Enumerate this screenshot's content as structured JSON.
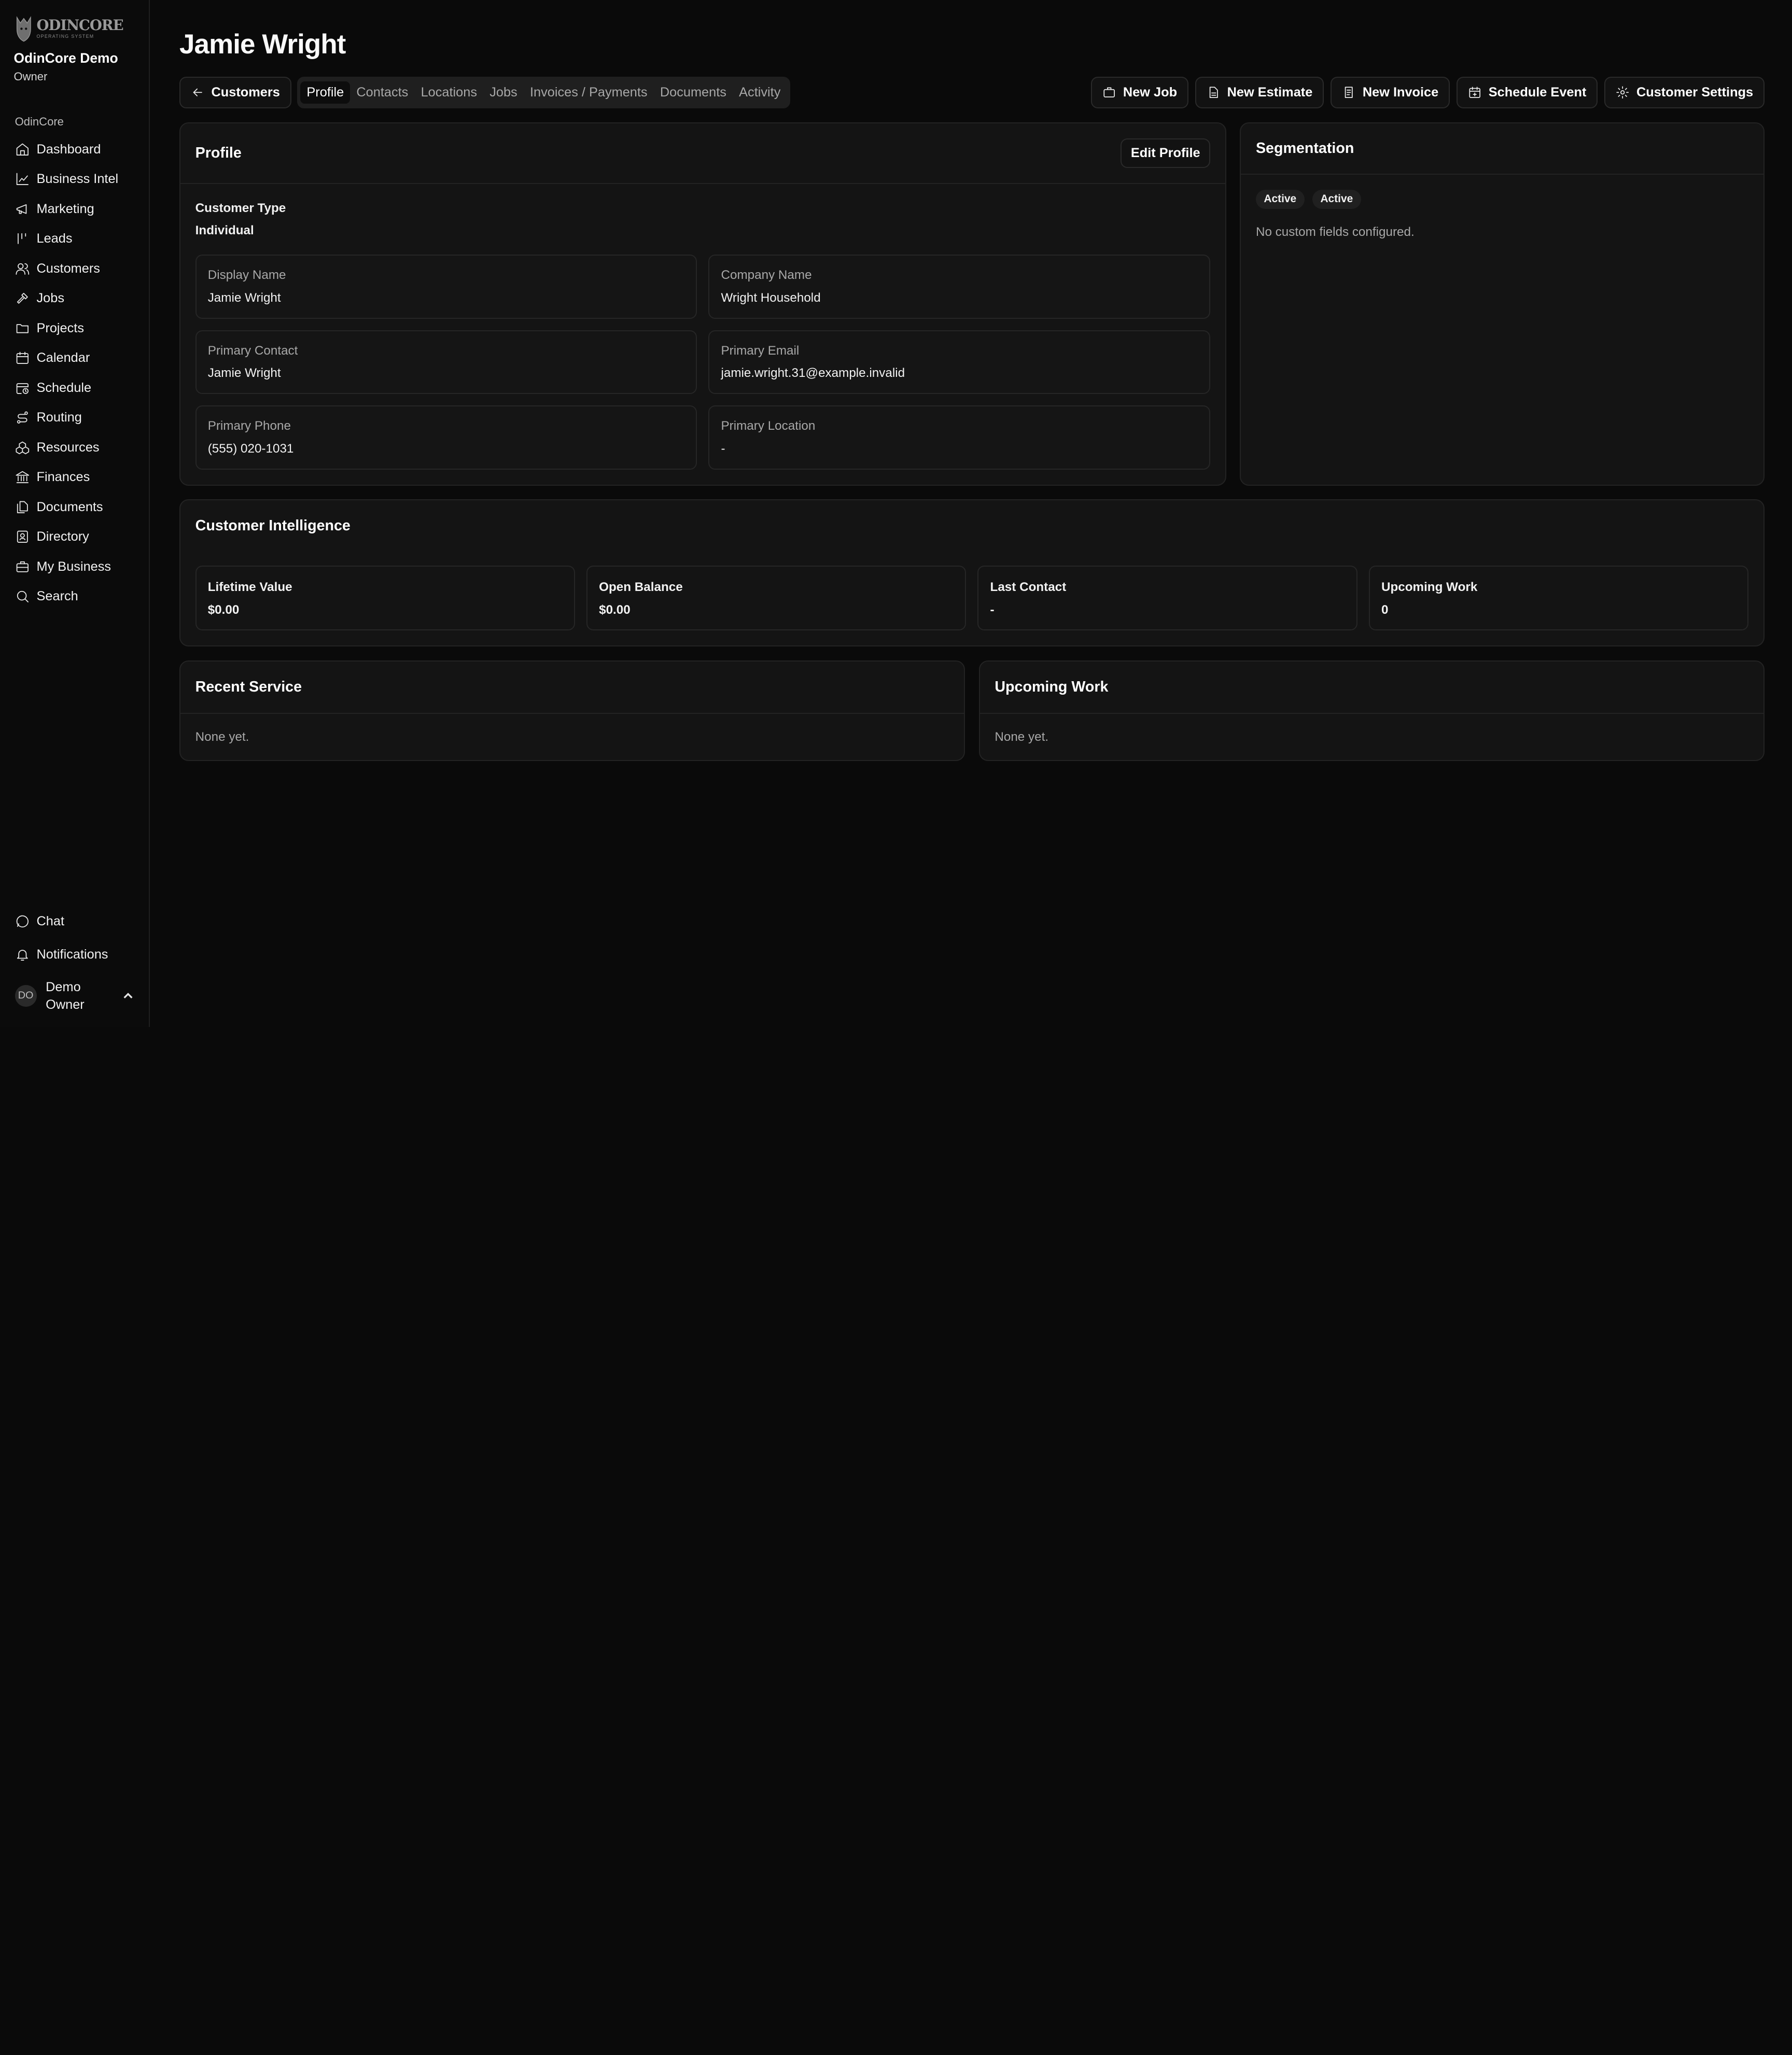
{
  "brand": {
    "logo_word": "ODINCORE",
    "logo_sub": "OPERATING SYSTEM",
    "org_name": "OdinCore Demo",
    "org_role": "Owner"
  },
  "sidebar": {
    "section_label": "OdinCore",
    "items": [
      {
        "label": "Dashboard",
        "icon": "home-icon"
      },
      {
        "label": "Business Intel",
        "icon": "chart-line-icon"
      },
      {
        "label": "Marketing",
        "icon": "megaphone-icon"
      },
      {
        "label": "Leads",
        "icon": "leads-icon"
      },
      {
        "label": "Customers",
        "icon": "users-icon"
      },
      {
        "label": "Jobs",
        "icon": "hammer-icon"
      },
      {
        "label": "Projects",
        "icon": "folder-icon"
      },
      {
        "label": "Calendar",
        "icon": "calendar-icon"
      },
      {
        "label": "Schedule",
        "icon": "calendar-clock-icon"
      },
      {
        "label": "Routing",
        "icon": "route-icon"
      },
      {
        "label": "Resources",
        "icon": "boxes-icon"
      },
      {
        "label": "Finances",
        "icon": "landmark-icon"
      },
      {
        "label": "Documents",
        "icon": "files-icon"
      },
      {
        "label": "Directory",
        "icon": "contact-book-icon"
      },
      {
        "label": "My Business",
        "icon": "briefcase-icon"
      },
      {
        "label": "Search",
        "icon": "search-icon"
      }
    ],
    "bottom": {
      "chat": "Chat",
      "notifications": "Notifications"
    },
    "user": {
      "initials": "DO",
      "name_line1": "Demo",
      "name_line2": "Owner"
    }
  },
  "header": {
    "title": "Jamie Wright"
  },
  "toolbar": {
    "back_label": "Customers",
    "tabs": [
      "Profile",
      "Contacts",
      "Locations",
      "Jobs",
      "Invoices / Payments",
      "Documents",
      "Activity"
    ],
    "actions": [
      "New Job",
      "New Estimate",
      "New Invoice",
      "Schedule Event",
      "Customer Settings"
    ]
  },
  "profile": {
    "title": "Profile",
    "edit_label": "Edit Profile",
    "customer_type_label": "Customer Type",
    "customer_type_value": "Individual",
    "fields": [
      {
        "label": "Display Name",
        "value": "Jamie Wright"
      },
      {
        "label": "Company Name",
        "value": "Wright Household"
      },
      {
        "label": "Primary Contact",
        "value": "Jamie Wright"
      },
      {
        "label": "Primary Email",
        "value": "jamie.wright.31@example.invalid"
      },
      {
        "label": "Primary Phone",
        "value": "(555) 020-1031"
      },
      {
        "label": "Primary Location",
        "value": "-"
      }
    ]
  },
  "segmentation": {
    "title": "Segmentation",
    "badges": [
      "Active",
      "Active"
    ],
    "note": "No custom fields configured."
  },
  "intelligence": {
    "title": "Customer Intelligence",
    "metrics": [
      {
        "label": "Lifetime Value",
        "value": "$0.00"
      },
      {
        "label": "Open Balance",
        "value": "$0.00"
      },
      {
        "label": "Last Contact",
        "value": "-"
      },
      {
        "label": "Upcoming Work",
        "value": "0"
      }
    ]
  },
  "recent_service": {
    "title": "Recent Service",
    "empty": "None yet."
  },
  "upcoming_work": {
    "title": "Upcoming Work",
    "empty": "None yet."
  }
}
